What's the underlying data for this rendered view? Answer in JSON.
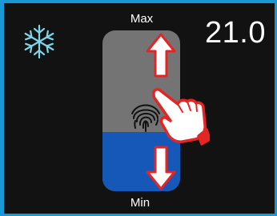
{
  "thermostat": {
    "temperature": "21.0",
    "max_label": "Max",
    "min_label": "Min",
    "mode_icon": "snowflake-icon",
    "slider_level": 0.37,
    "colors": {
      "frame": "#1a98d3",
      "screen": "#121212",
      "slider_track": "#747474",
      "slider_fill": "#1558b8",
      "arrow": "#e32525",
      "snowflake": "#7fd4ea"
    }
  }
}
